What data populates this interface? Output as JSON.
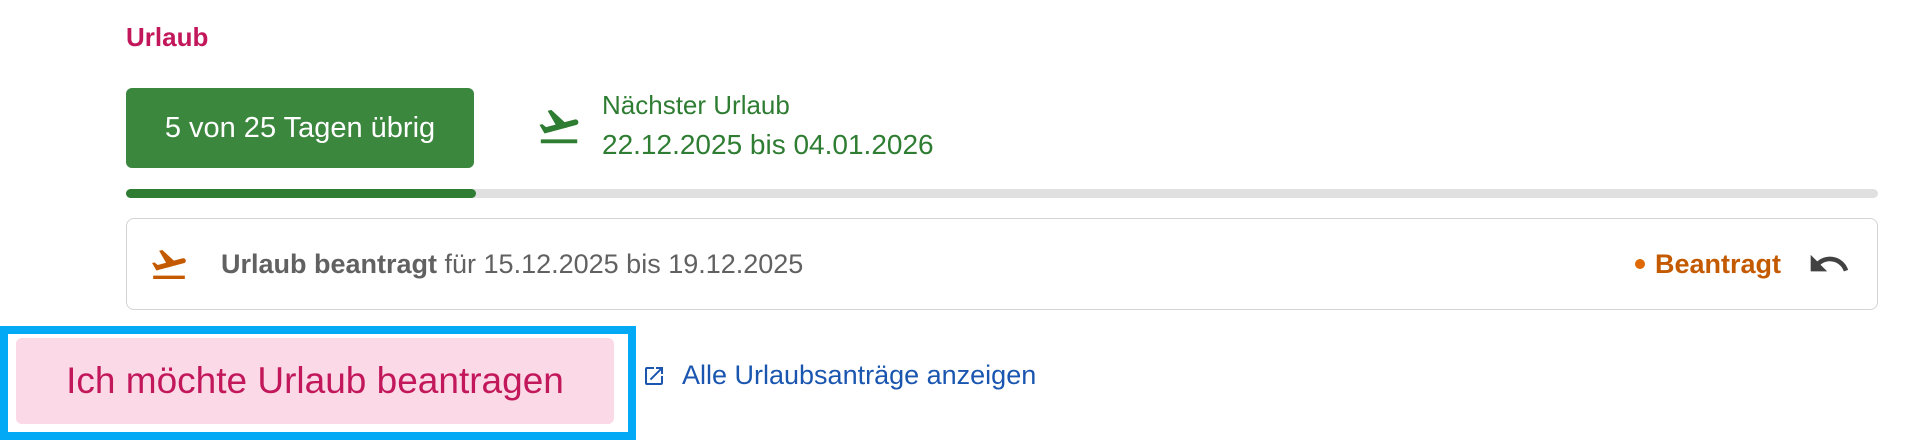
{
  "section": {
    "title": "Urlaub"
  },
  "balance": {
    "label": "5 von 25 Tagen übrig",
    "used_fraction": 0.2
  },
  "next_vacation": {
    "label": "Nächster Urlaub",
    "range": "22.12.2025 bis 04.01.2026",
    "icon": "airplane-takeoff-icon"
  },
  "request": {
    "title": "Urlaub beantragt",
    "detail": " für 15.12.2025 bis 19.12.2025",
    "status": "Beantragt",
    "icon": "airplane-takeoff-icon",
    "action_icon": "undo-icon"
  },
  "actions": {
    "request_button": "Ich möchte Urlaub beantragen",
    "all_requests_link": "Alle Urlaubsanträge anzeigen",
    "link_icon": "external-link-icon"
  },
  "colors": {
    "accent": "#c2185b",
    "success": "#2e7d32",
    "warning": "#c45a00",
    "link": "#1a56b0",
    "highlight": "#03a9f4"
  }
}
